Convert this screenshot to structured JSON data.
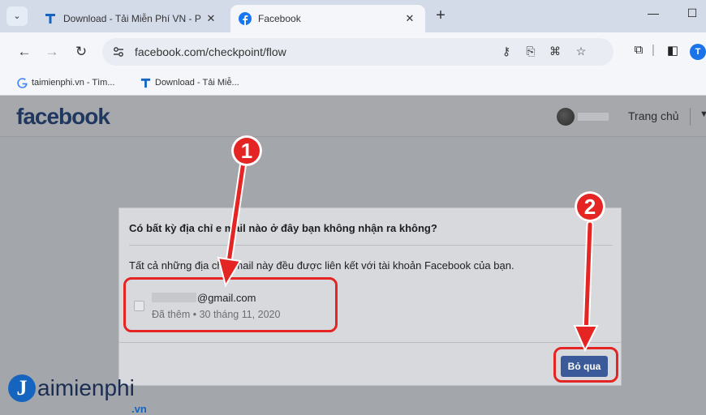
{
  "browser": {
    "tabs": [
      {
        "title": "Download - Tải Miễn Phí VN - P",
        "favicon": "taimienphi-t-icon",
        "active": false
      },
      {
        "title": "Facebook",
        "favicon": "facebook-icon",
        "active": true
      }
    ],
    "new_tab_symbol": "+",
    "url": "facebook.com/checkpoint/flow",
    "bookmarks": [
      {
        "label": "taimienphi.vn - Tìm...",
        "favicon": "google-g-icon"
      },
      {
        "label": "Download - Tải Miễ...",
        "favicon": "taimienphi-t-icon"
      }
    ],
    "profile_initial": "T"
  },
  "facebook": {
    "logo": "facebook",
    "home_label": "Trang chủ"
  },
  "dialog": {
    "title": "Có bất kỳ địa chỉ e mail nào ở đây bạn không nhận ra không?",
    "description": "Tất cả những địa chỉ email này đều được liên kết với tài khoản Facebook của bạn.",
    "email": "@gmail.com",
    "added": "Đã thêm • 30 tháng 11, 2020",
    "skip_button": "Bỏ qua"
  },
  "annotations": {
    "marker_1": "1",
    "marker_2": "2",
    "color": "#e52424"
  },
  "watermark": {
    "initial": "J",
    "text": "aimienphi",
    "suffix": ".vn"
  },
  "colors": {
    "facebook_blue": "#3b5a9a",
    "overlay_gray": "#a3a6ab"
  }
}
